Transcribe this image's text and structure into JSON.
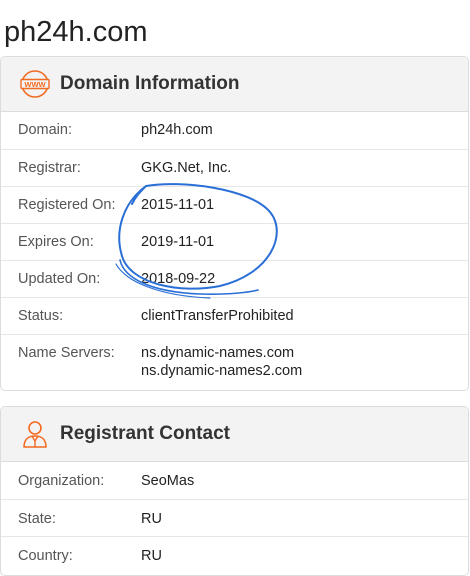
{
  "page_title": "ph24h.com",
  "domain_info": {
    "title": "Domain Information",
    "icon": "www-icon",
    "rows": [
      {
        "label": "Domain:",
        "value": "ph24h.com"
      },
      {
        "label": "Registrar:",
        "value": "GKG.Net, Inc."
      },
      {
        "label": "Registered On:",
        "value": "2015-11-01"
      },
      {
        "label": "Expires On:",
        "value": "2019-11-01"
      },
      {
        "label": "Updated On:",
        "value": "2018-09-22"
      },
      {
        "label": "Status:",
        "value": "clientTransferProhibited"
      }
    ],
    "name_servers": {
      "label": "Name Servers:",
      "values": [
        "ns.dynamic-names.com",
        "ns.dynamic-names2.com"
      ]
    }
  },
  "registrant": {
    "title": "Registrant Contact",
    "icon": "person-icon",
    "rows": [
      {
        "label": "Organization:",
        "value": "SeoMas"
      },
      {
        "label": "State:",
        "value": "RU"
      },
      {
        "label": "Country:",
        "value": "RU"
      }
    ]
  },
  "colors": {
    "accent": "#f26b21",
    "annotation": "#2a6fd6"
  }
}
